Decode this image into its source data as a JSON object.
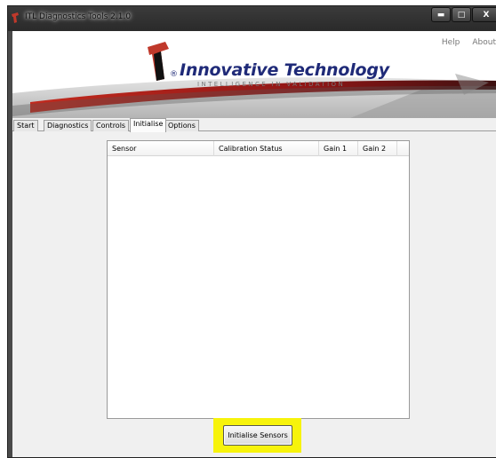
{
  "window": {
    "title": "ITL Diagnostics Tools 2.1.0",
    "controls": [
      "▬",
      "□",
      "X"
    ]
  },
  "header": {
    "links": [
      "Help",
      "About"
    ],
    "brand": {
      "name": "Innovative Technology",
      "registered": "®",
      "tagline": "INTELLIGENCE IN VALIDATION"
    }
  },
  "tabs": [
    "Start",
    "Diagnostics",
    "Controls",
    "Initialise",
    "Options"
  ],
  "active_tab": "Initialise",
  "sensor_table": {
    "columns": [
      "Sensor",
      "Calibration Status",
      "Gain 1",
      "Gain 2"
    ],
    "rows": []
  },
  "actions": {
    "initialise_label": "Initialise Sensors"
  },
  "colors": {
    "brand_blue": "#1f2a78",
    "brand_red": "#b11a1a",
    "highlight": "#f7f30b"
  }
}
